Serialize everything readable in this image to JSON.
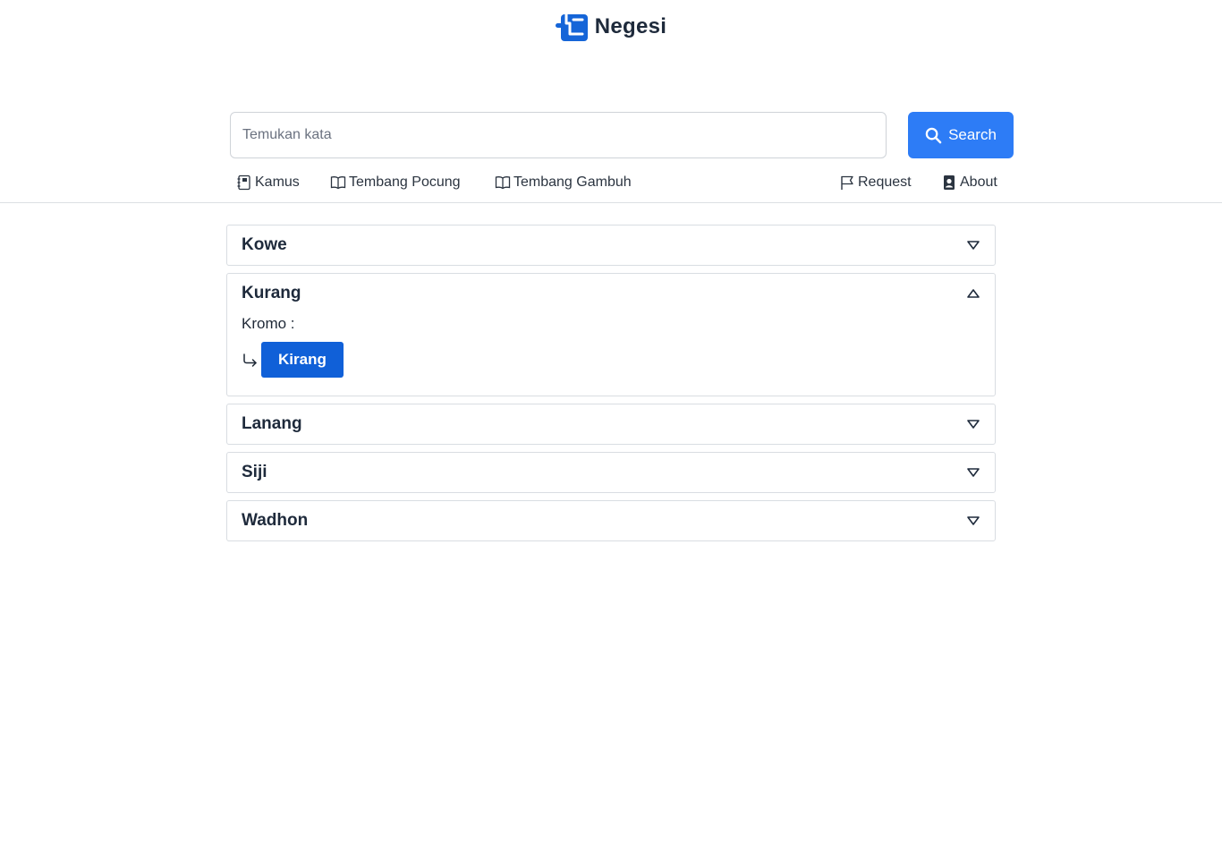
{
  "brand": {
    "name": "Negesi",
    "icon": "negesi-logo",
    "color": "#1565d8"
  },
  "search": {
    "placeholder": "Temukan kata",
    "value": "",
    "button_label": "Search"
  },
  "nav": {
    "left": [
      {
        "label": "Kamus",
        "icon": "notebook-icon"
      },
      {
        "label": "Tembang Pocung",
        "icon": "book-open-icon"
      },
      {
        "label": "Tembang Gambuh",
        "icon": "book-open-icon"
      }
    ],
    "right": [
      {
        "label": "Request",
        "icon": "flag-icon"
      },
      {
        "label": "About",
        "icon": "person-badge-icon"
      }
    ]
  },
  "accordion": {
    "items": [
      {
        "title": "Kowe",
        "expanded": false
      },
      {
        "title": "Kurang",
        "expanded": true,
        "kromo_label": "Kromo :",
        "kromo_value": "Kirang"
      },
      {
        "title": "Lanang",
        "expanded": false
      },
      {
        "title": "Siji",
        "expanded": false
      },
      {
        "title": "Wadhon",
        "expanded": false
      }
    ]
  },
  "colors": {
    "accent": "#2d7cf6",
    "kromo_button": "#1060d8",
    "text_dark": "#1e2a3b",
    "border": "#d9dde2"
  }
}
